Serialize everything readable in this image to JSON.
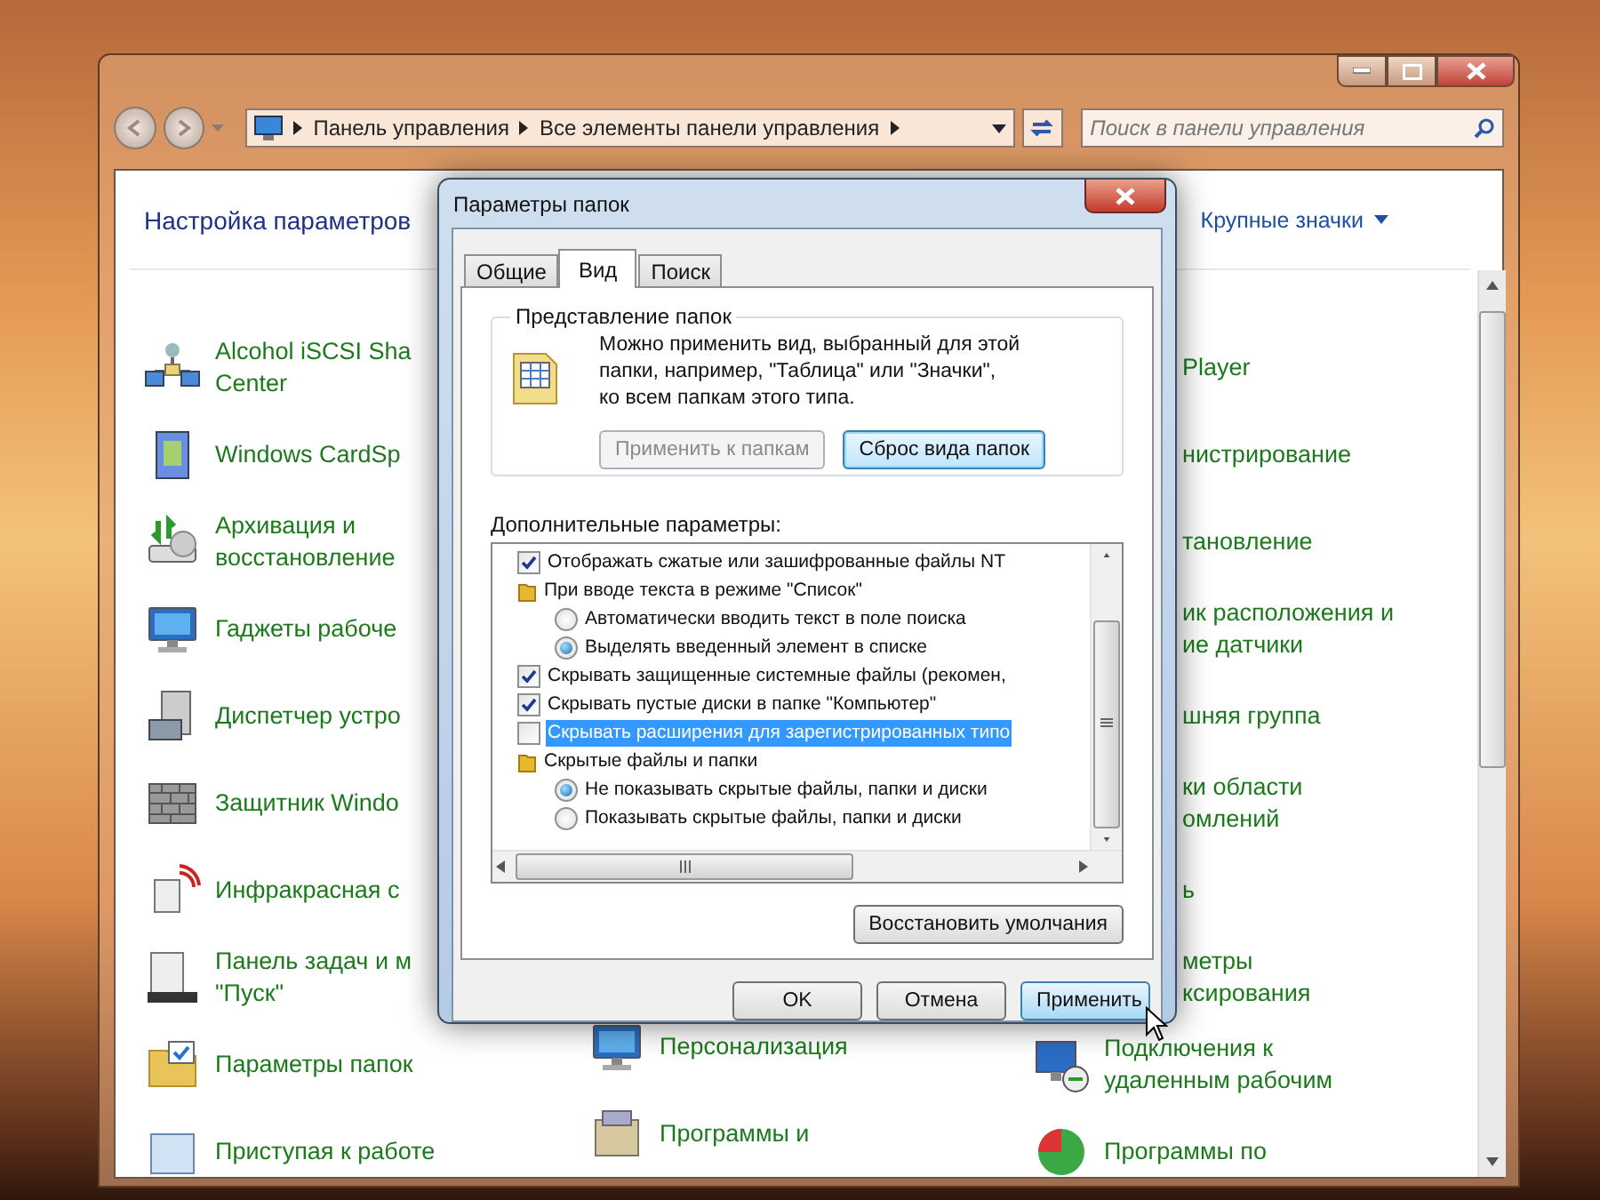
{
  "nav": {
    "breadcrumb": [
      "Панель управления",
      "Все элементы панели управления"
    ],
    "search": {
      "placeholder": "Поиск в панели управления"
    }
  },
  "header": {
    "title": "Настройка параметров",
    "view": "Крупные значки"
  },
  "columns": [
    {
      "items": [
        {
          "kind": "icon",
          "text": "Alcohol iSCSI Sha\nCenter"
        },
        {
          "kind": "icon",
          "text": "Windows CardSp"
        },
        {
          "kind": "icon",
          "text": "Архивация и\nвосстановление"
        },
        {
          "kind": "icon",
          "text": "Гаджеты рабоче"
        },
        {
          "kind": "icon",
          "text": "Диспетчер устро"
        },
        {
          "kind": "icon",
          "text": "Защитник Windo"
        },
        {
          "kind": "icon",
          "text": "Инфракрасная с"
        },
        {
          "kind": "icon",
          "text": "Панель задач и м\n\"Пуск\""
        },
        {
          "kind": "icon",
          "text": "Параметры папок"
        },
        {
          "kind": "icon",
          "text": "Приступая к работе"
        }
      ]
    },
    {
      "items": [
        {
          "kind": "icon",
          "text": "Персонализация"
        },
        {
          "kind": "icon",
          "text": "Программы и"
        }
      ]
    },
    {
      "items": [
        {
          "kind": "text",
          "text": "Player"
        },
        {
          "kind": "text",
          "text": "нистрирование"
        },
        {
          "kind": "text",
          "text": "тановление"
        },
        {
          "kind": "text",
          "text": "ик расположения и\nие датчики"
        },
        {
          "kind": "text",
          "text": "шняя группа"
        },
        {
          "kind": "text",
          "text": "ки области\nомлений"
        },
        {
          "kind": "text",
          "text": "ь"
        },
        {
          "kind": "text",
          "text": "метры\nксирования"
        },
        {
          "kind": "icon",
          "text": "Подключения к\nудаленным рабочим"
        },
        {
          "kind": "icon",
          "text": "Программы по"
        }
      ]
    }
  ],
  "dialog": {
    "title": "Параметры папок",
    "tabs": [
      {
        "label": "Общие",
        "selected": false
      },
      {
        "label": "Вид",
        "selected": true
      },
      {
        "label": "Поиск",
        "selected": false
      }
    ],
    "group": {
      "legend": "Представление папок",
      "text": "Можно применить вид, выбранный для этой\nпапки, например, \"Таблица\" или \"Значки\",\nко всем папкам этого типа.",
      "buttons": [
        {
          "label": "Применить к папкам",
          "disabled": true,
          "focused": false
        },
        {
          "label": "Сброс вида папок",
          "disabled": false,
          "focused": true
        }
      ]
    },
    "advanced_label": "Дополнительные параметры:",
    "tree": [
      {
        "kind": "checkbox",
        "text": "Отображать сжатые или зашифрованные файлы NT",
        "checked": true,
        "selected": false
      },
      {
        "kind": "folder",
        "text": "При вводе текста в режиме \"Список\"",
        "selected": false,
        "children": [
          {
            "kind": "radio",
            "text": "Автоматически вводить текст в поле поиска",
            "checked": false,
            "selected": false
          },
          {
            "kind": "radio",
            "text": "Выделять введенный элемент в списке",
            "checked": true,
            "selected": false
          }
        ]
      },
      {
        "kind": "checkbox",
        "text": "Скрывать защищенные системные файлы (рекомен,",
        "checked": true,
        "selected": false
      },
      {
        "kind": "checkbox",
        "text": "Скрывать пустые диски в папке \"Компьютер\"",
        "checked": true,
        "selected": false
      },
      {
        "kind": "checkbox",
        "text": "Скрывать расширения для зарегистрированных типо",
        "checked": false,
        "selected": true
      },
      {
        "kind": "folder",
        "text": "Скрытые файлы и папки",
        "selected": false,
        "children": [
          {
            "kind": "radio",
            "text": "Не показывать скрытые файлы, папки и диски",
            "checked": true,
            "selected": false
          },
          {
            "kind": "radio",
            "text": "Показывать скрытые файлы, папки и диски",
            "checked": false,
            "selected": false
          }
        ]
      }
    ],
    "restore_button": "Восстановить умолчания",
    "buttons": [
      {
        "label": "OK",
        "hover": false
      },
      {
        "label": "Отмена",
        "hover": false
      },
      {
        "label": "Применить",
        "hover": true
      }
    ]
  }
}
